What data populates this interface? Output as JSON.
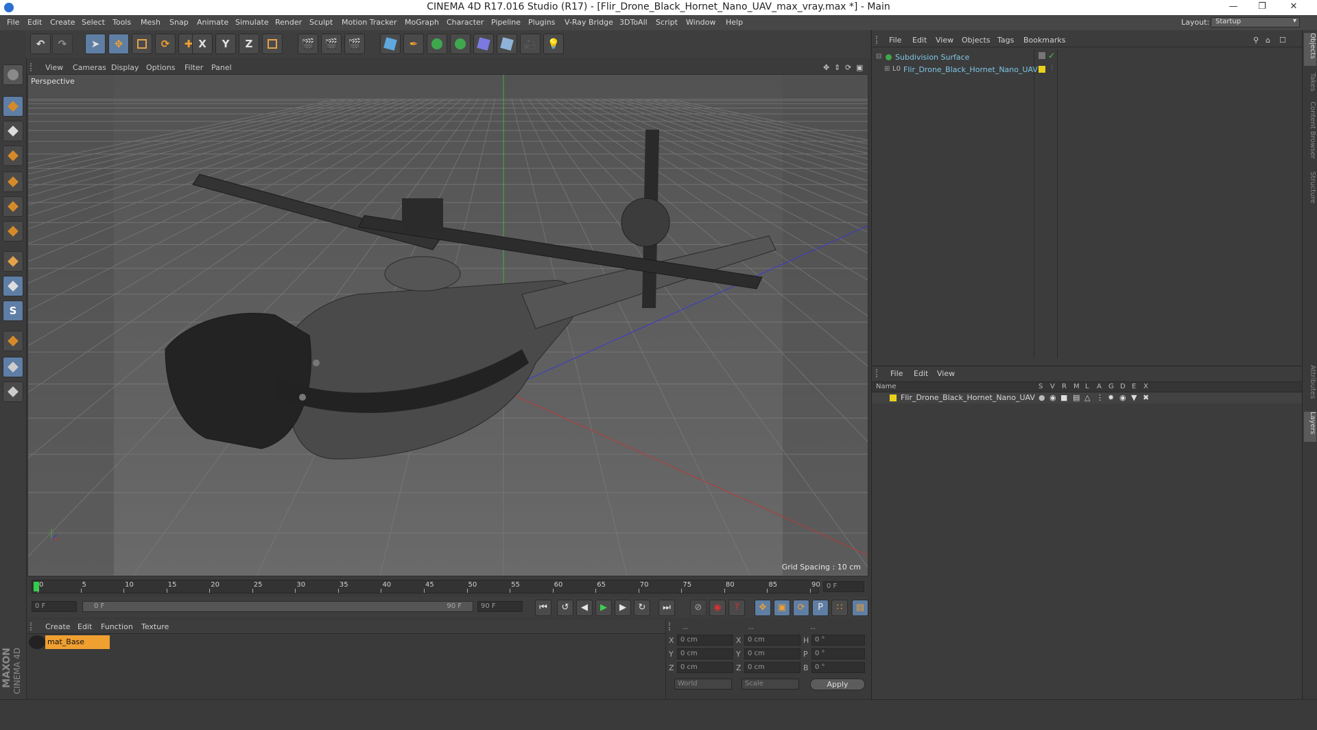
{
  "window": {
    "title": "CINEMA 4D R17.016 Studio (R17) - [Flir_Drone_Black_Hornet_Nano_UAV_max_vray.max *] - Main",
    "controls": [
      "minimize-icon",
      "restore-icon",
      "close-icon"
    ]
  },
  "menubar": {
    "items": [
      "File",
      "Edit",
      "Create",
      "Select",
      "Tools",
      "Mesh",
      "Snap",
      "Animate",
      "Simulate",
      "Render",
      "Sculpt",
      "Motion Tracker",
      "MoGraph",
      "Character",
      "Pipeline",
      "Plugins",
      "V-Ray Bridge",
      "3DToAll",
      "Script",
      "Window",
      "Help"
    ],
    "layout_label": "Layout:",
    "layout_value": "Startup"
  },
  "viewport": {
    "menu": [
      "View",
      "Cameras",
      "Display",
      "Options",
      "Filter",
      "Panel"
    ],
    "label": "Perspective",
    "grid_spacing": "Grid Spacing : 10 cm"
  },
  "timeline": {
    "ticks": [
      "0",
      "5",
      "10",
      "15",
      "20",
      "25",
      "30",
      "35",
      "40",
      "45",
      "50",
      "55",
      "60",
      "65",
      "70",
      "75",
      "80",
      "85",
      "90"
    ],
    "current_frame": "0 F",
    "start_field": "0 F",
    "range_start": "0 F",
    "range_end": "90 F",
    "end_field": "90 F"
  },
  "material_panel": {
    "menu": [
      "Create",
      "Edit",
      "Function",
      "Texture"
    ],
    "material_name": "mat_Base"
  },
  "coordinates": {
    "headers": [
      "--",
      "--",
      "--"
    ],
    "rows": [
      {
        "a_label": "X",
        "a_value": "0 cm",
        "b_label": "X",
        "b_value": "0 cm",
        "c_label": "H",
        "c_value": "0 °"
      },
      {
        "a_label": "Y",
        "a_value": "0 cm",
        "b_label": "Y",
        "b_value": "0 cm",
        "c_label": "P",
        "c_value": "0 °"
      },
      {
        "a_label": "Z",
        "a_value": "0 cm",
        "b_label": "Z",
        "b_value": "0 cm",
        "c_label": "B",
        "c_value": "0 °"
      }
    ],
    "mode": "World",
    "transform": "Scale",
    "apply": "Apply"
  },
  "objects_panel": {
    "menu": [
      "File",
      "Edit",
      "View",
      "Objects",
      "Tags",
      "Bookmarks"
    ],
    "tree": [
      {
        "name": "Subdivision Surface"
      },
      {
        "name": "Flir_Drone_Black_Hornet_Nano_UAV"
      }
    ]
  },
  "layers_panel": {
    "menu": [
      "File",
      "Edit",
      "View"
    ],
    "col_name": "Name",
    "col_flags": [
      "S",
      "V",
      "R",
      "M",
      "L",
      "A",
      "G",
      "D",
      "E",
      "X"
    ],
    "rows": [
      {
        "name": "Flir_Drone_Black_Hornet_Nano_UAV"
      }
    ]
  },
  "side_tabs": [
    "Objects",
    "Takes",
    "Content Browser",
    "Structure",
    "Attributes",
    "Layers"
  ],
  "brand": {
    "line1": "MAXON",
    "line2": "CINEMA 4D"
  },
  "colors": {
    "accent_orange": "#f0a030",
    "layer_yellow": "#e8d31a",
    "axis_red": "#b83a3a",
    "axis_blue": "#3a3ad0",
    "axis_green": "#3bb33b"
  }
}
